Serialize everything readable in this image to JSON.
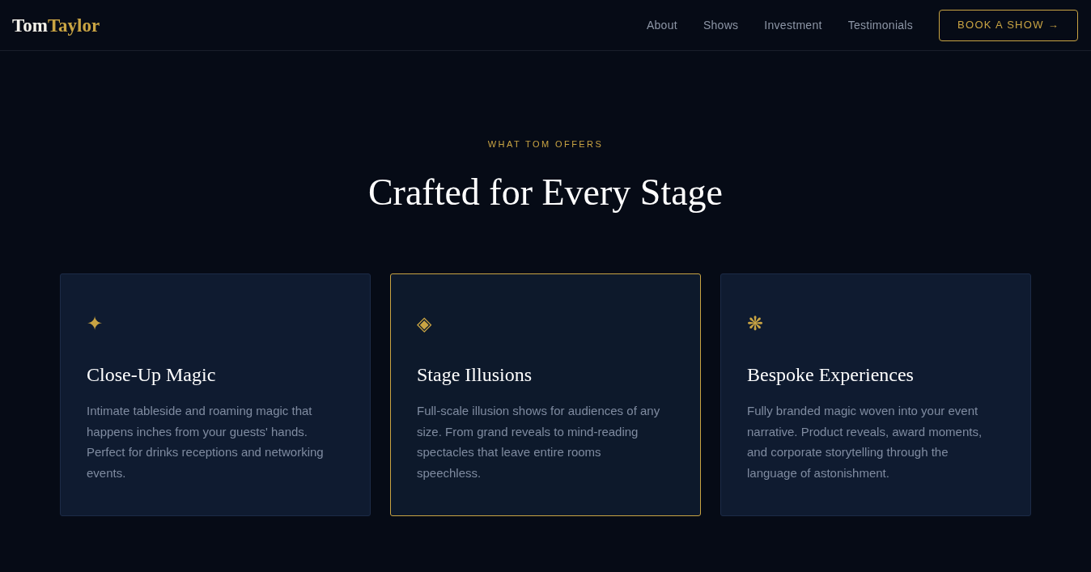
{
  "header": {
    "logo": {
      "primary": "Tom",
      "accent": "Taylor"
    },
    "nav_links": [
      "About",
      "Shows",
      "Investment",
      "Testimonials"
    ],
    "cta": "BOOK A SHOW →"
  },
  "section": {
    "eyebrow": "WHAT TOM OFFERS",
    "title": "Crafted for Every Stage"
  },
  "cards": [
    {
      "icon": "✦",
      "title": "Close-Up Magic",
      "text": "Intimate tableside and roaming magic that happens inches from your guests' hands. Perfect for drinks receptions and networking events.",
      "selected": false
    },
    {
      "icon": "◈",
      "title": "Stage Illusions",
      "text": "Full-scale illusion shows for audiences of any size. From grand reveals to mind-reading spectacles that leave entire rooms speechless.",
      "selected": true
    },
    {
      "icon": "❋",
      "title": "Bespoke Experiences",
      "text": "Fully branded magic woven into your event narrative. Product reveals, award moments, and corporate storytelling through the language of astonishment.",
      "selected": false
    }
  ]
}
